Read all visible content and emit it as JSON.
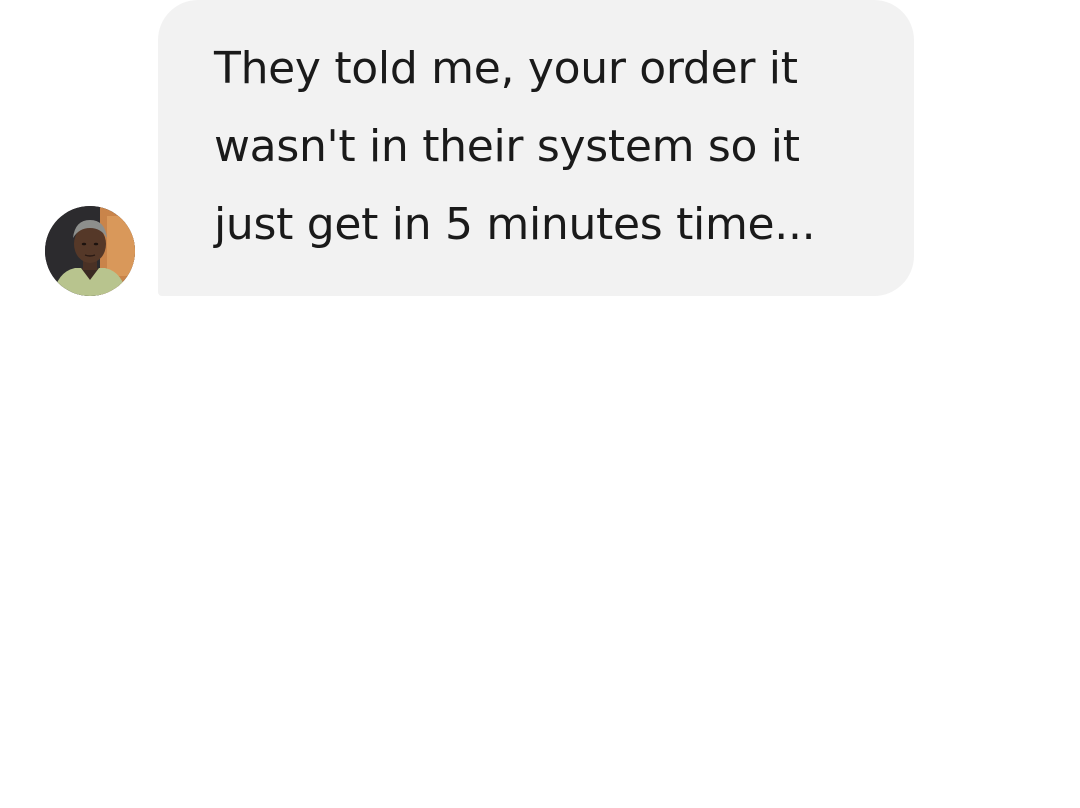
{
  "message": {
    "sender_avatar": "avatar-photo",
    "text": "They told me, your order it\nwasn't in their system so it\njust get in 5 minutes time..."
  },
  "colors": {
    "bubble": "#f2f2f2",
    "text": "#1a1a1a",
    "background": "#ffffff"
  }
}
